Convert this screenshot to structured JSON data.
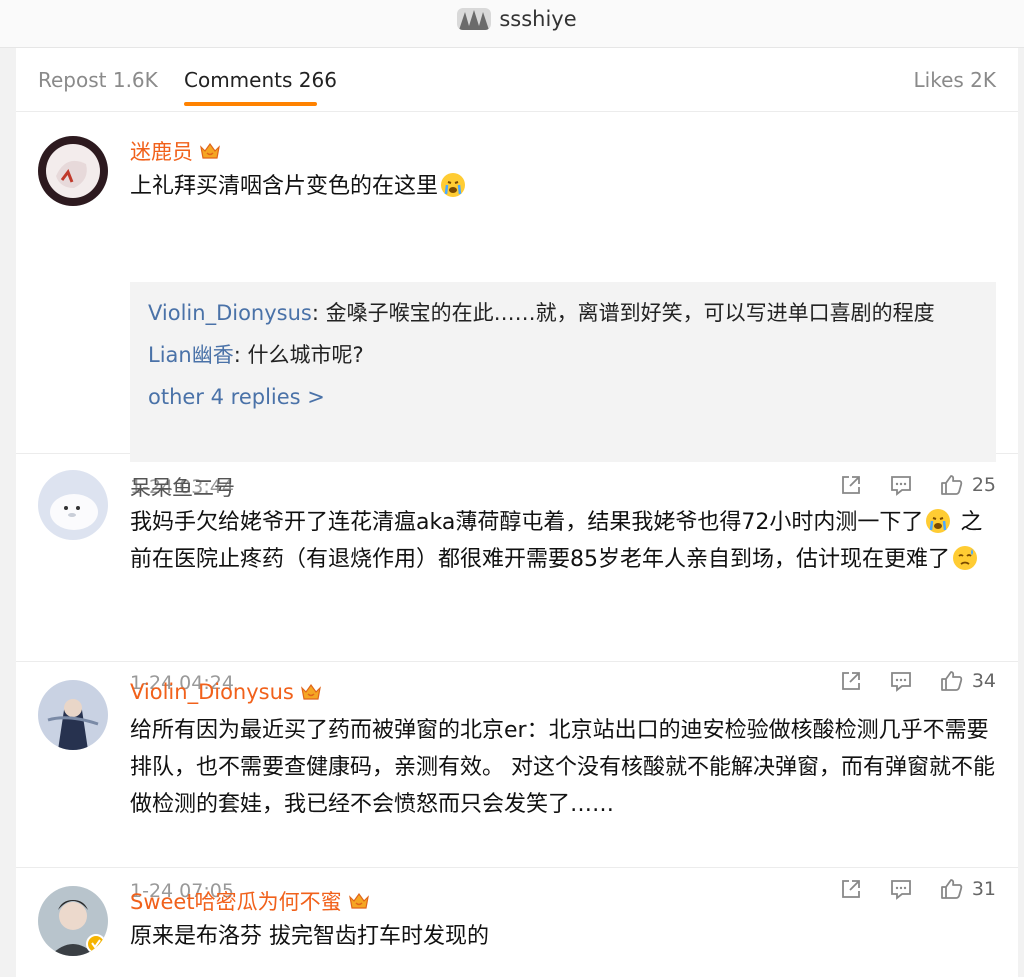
{
  "header": {
    "username": "ssshiye"
  },
  "tabs": [
    {
      "label": "Repost 1.6K"
    },
    {
      "label": "Comments 266"
    },
    {
      "label": "Likes 2K"
    }
  ],
  "comments": [
    {
      "username": "迷鹿员",
      "text": "上礼拜买清咽含片变色的在这里",
      "replies": [
        {
          "name": "Violin_Dionysus",
          "text": ": 金嗓子喉宝的在此……就，离谱到好笑，可以写进单口喜剧的程度"
        },
        {
          "name": "Lian幽香",
          "text": ": 什么城市呢?"
        }
      ],
      "more_replies": "other 4 replies >",
      "time": "1-24 03:44",
      "likes": "25"
    },
    {
      "username": "呆呆鱼二号",
      "text_a": "我妈手欠给姥爷开了连花清瘟aka薄荷醇屯着，结果我姥爷也得72小时内测一下了",
      "text_b": " 之前在医院止疼药（有退烧作用）都很难开需要85岁老年人亲自到场，估计现在更难了",
      "time": "1-24 04:24",
      "likes": "34"
    },
    {
      "username": "Violin_Dionysus",
      "text": "给所有因为最近买了药而被弹窗的北京er：北京站出口的迪安检验做核酸检测几乎不需要排队，也不需要查健康码，亲测有效。 对这个没有核酸就不能解决弹窗，而有弹窗就不能做检测的套娃，我已经不会愤怒而只会发笑了……",
      "time": "1-24 07:05",
      "likes": "31"
    },
    {
      "username": "Sweet哈密瓜为何不蜜",
      "text": "原来是布洛芬 拔完智齿打车时发现的"
    }
  ],
  "colors": {
    "accent": "#ff8200",
    "vip_name": "#f1611b",
    "link": "#4a72a8"
  }
}
